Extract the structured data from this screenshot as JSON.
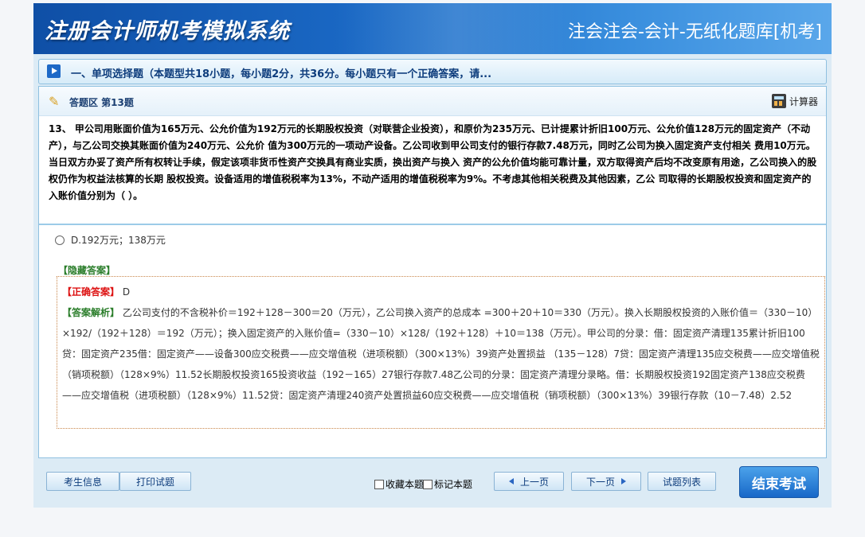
{
  "header": {
    "title": "注册会计师机考模拟系统",
    "subtitle": "注会注会-会计-无纸化题库[机考]"
  },
  "section": {
    "text": "一、单项选择题（本题型共18小题，每小题2分，共36分。每小题只有一个正确答案，请..."
  },
  "answer_area": {
    "label": "答题区 第13题",
    "calculator_label": "计算器"
  },
  "question": {
    "text": "13、 甲公司用账面价值为165万元、公允价值为192万元的长期股权投资（对联营企业投资），和原价为235万元、已计提累计折旧100万元、公允价值128万元的固定资产（不动产），与乙公司交换其账面价值为240万元、公允价 值为300万元的一项动产设备。乙公司收到甲公司支付的银行存款7.48万元，同时乙公司为换入固定资产支付相关 费用10万元。当日双方办妥了资产所有权转让手续，假定该项非货币性资产交换具有商业实质，换出资产与换入 资产的公允价值均能可靠计量，双方取得资产后均不改变原有用途，乙公司换入的股权仍作为权益法核算的长期 股权投资。设备适用的增值税税率为13%，不动产适用的增值税税率为9%。不考虑其他相关税费及其他因素，乙公 司取得的长期股权投资和固定资产的入账价值分别为（ ）。"
  },
  "option": {
    "label": "D.192万元；138万元"
  },
  "hidden_answer_label": "【隐藏答案】",
  "correct": {
    "label": "【正确答案】",
    "value": "D"
  },
  "analysis": {
    "label": "【答案解析】",
    "text": "乙公司支付的不含税补价＝192＋128－300＝20（万元），乙公司换入资产的总成本 =300＋20＋10＝330（万元）。换入长期股权投资的入账价值＝（330－10）×192/（192＋128）＝192（万元）；换入固定资产的入账价值=（330－10）×128/（192＋128）＋10＝138（万元）。甲公司的分录：借：固定资产清理135累计折旧100贷：固定资产235借：固定资产——设备300应交税费——应交增值税（进项税额）（300×13%）39资产处置损益 （135－128）7贷：固定资产清理135应交税费——应交增值税（销项税额）（128×9%）11.52长期股权投资165投资收益（192－165）27银行存款7.48乙公司的分录：固定资产清理分录略。借：长期股权投资192固定资产138应交税费——应交增值税（进项税额）（128×9%）11.52贷：固定资产清理240资产处置损益60应交税费——应交增值税（销项税额）（300×13%）39银行存款（10－7.48）2.52"
  },
  "footer": {
    "candidate_info": "考生信息",
    "print_question": "打印试题",
    "bookmark": "收藏本题",
    "mark": "标记本题",
    "prev": "上一页",
    "next": "下一页",
    "question_list": "试题列表",
    "end_exam": "结束考试"
  }
}
